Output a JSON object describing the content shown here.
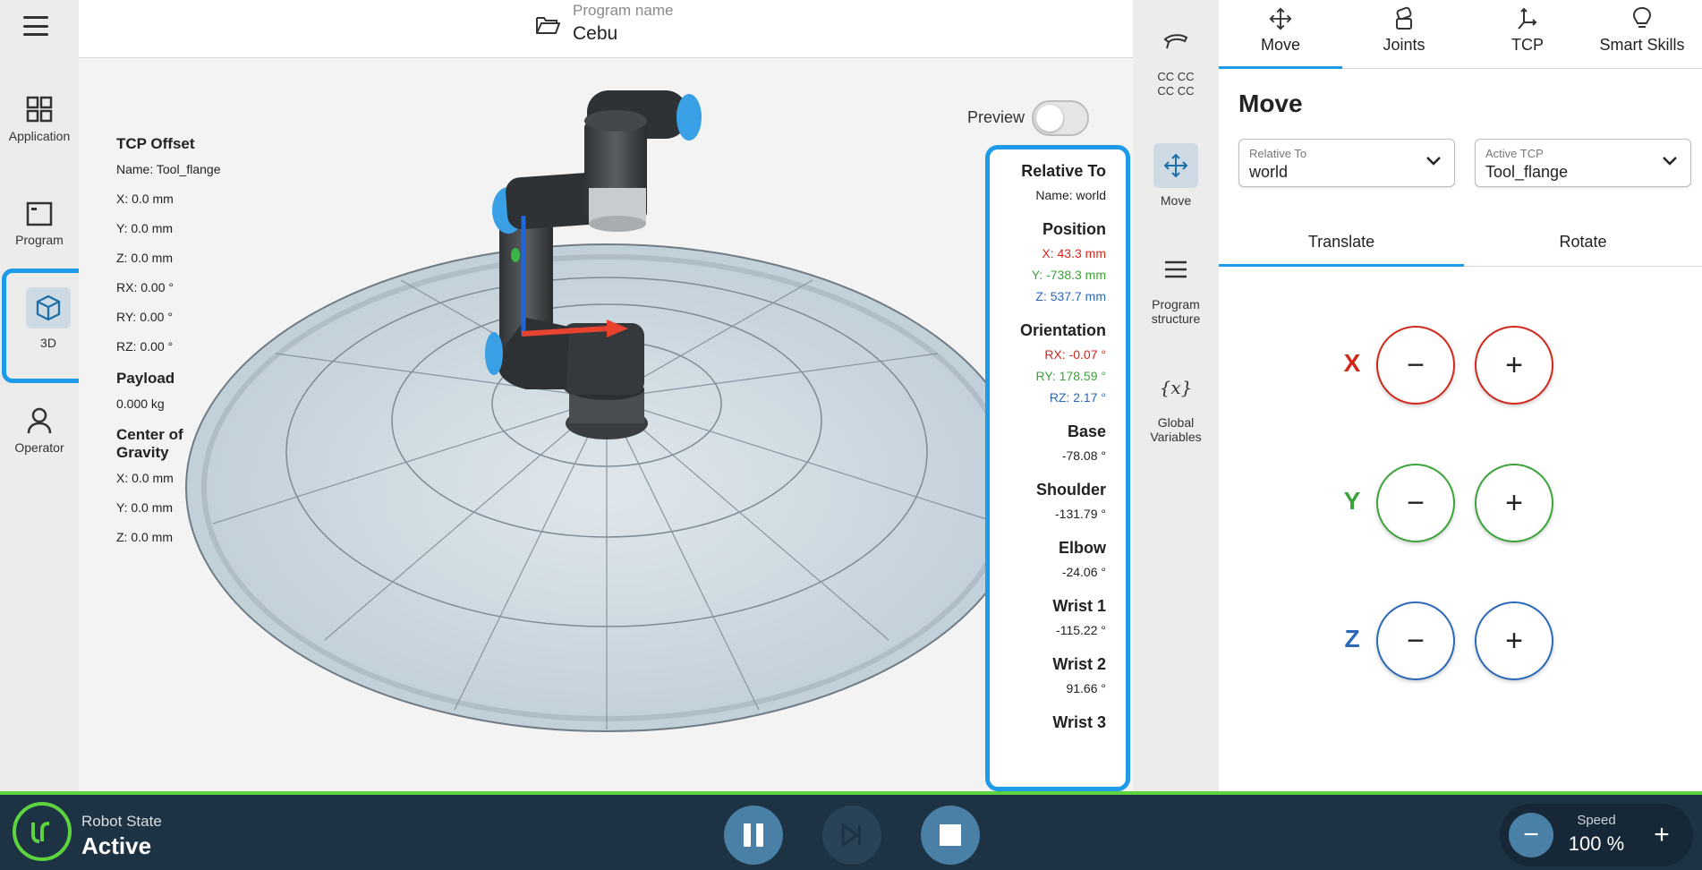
{
  "nav": {
    "items": [
      {
        "label": "Application",
        "icon": "grid-icon"
      },
      {
        "label": "Program",
        "icon": "program-window-icon"
      },
      {
        "label": "3D",
        "icon": "cube-icon"
      },
      {
        "label": "Operator",
        "icon": "person-icon"
      }
    ]
  },
  "header": {
    "program_label": "Program name",
    "program_name": "Cebu"
  },
  "tcp_offset": {
    "title": "TCP Offset",
    "name": "Name: Tool_flange",
    "x": "X: 0.0 mm",
    "y": "Y: 0.0 mm",
    "z": "Z: 0.0 mm",
    "rx": "RX: 0.00 °",
    "ry": "RY: 0.00 °",
    "rz": "RZ: 0.00 °",
    "payload_title": "Payload",
    "payload": "0.000 kg",
    "cog_title": "Center of Gravity",
    "cog_x": "X: 0.0 mm",
    "cog_y": "Y: 0.0 mm",
    "cog_z": "Z: 0.0 mm"
  },
  "preview": {
    "label": "Preview",
    "on": false
  },
  "readout": {
    "relative_title": "Relative To",
    "relative_name": "Name: world",
    "position_title": "Position",
    "pos_x": "X: 43.3 mm",
    "pos_y": "Y: -738.3 mm",
    "pos_z": "Z: 537.7 mm",
    "orientation_title": "Orientation",
    "rx": "RX: -0.07 °",
    "ry": "RY: 178.59 °",
    "rz": "RZ: 2.17 °",
    "base_title": "Base",
    "base": "-78.08 °",
    "shoulder_title": "Shoulder",
    "shoulder": "-131.79 °",
    "elbow_title": "Elbow",
    "elbow": "-24.06 °",
    "wrist1_title": "Wrist 1",
    "wrist1": "-115.22 °",
    "wrist2_title": "Wrist 2",
    "wrist2": "91.66 °",
    "wrist3_title": "Wrist 3"
  },
  "midbar": {
    "cc": "CC CC CC CC",
    "move": "Move",
    "program_structure": "Program structure",
    "global_variables": "Global Variables"
  },
  "right": {
    "tabs": [
      "Move",
      "Joints",
      "TCP",
      "Smart Skills"
    ],
    "title": "Move",
    "relative_label": "Relative To",
    "relative_value": "world",
    "tcp_label": "Active TCP",
    "tcp_value": "Tool_flange",
    "subtabs": [
      "Translate",
      "Rotate"
    ],
    "axes": [
      "X",
      "Y",
      "Z"
    ],
    "minus": "−",
    "plus": "+"
  },
  "bottom": {
    "state_label": "Robot State",
    "state_value": "Active",
    "speed_label": "Speed",
    "speed_value": "100 %",
    "speed_fraction": 1.0
  },
  "colors": {
    "accent": "#1e9be8",
    "x_axis": "#d0281b",
    "y_axis": "#3ba33a",
    "z_axis": "#2c68b8",
    "bottom_bg": "#1d3343",
    "status_green": "#5dd33f"
  }
}
